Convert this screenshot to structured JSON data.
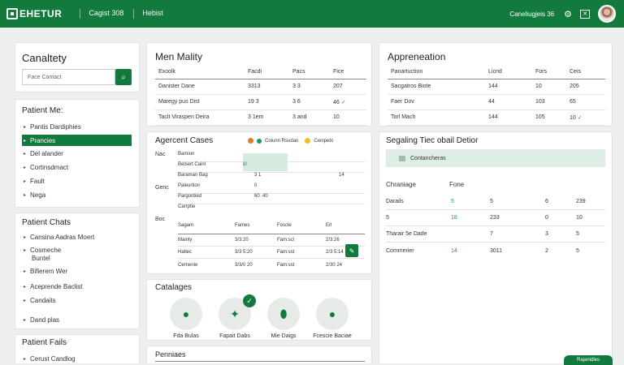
{
  "header": {
    "logo": "EHETUR",
    "logo_sub": "",
    "nav": [
      "Cagist 308",
      "Hebist"
    ],
    "user_text": "Caneliugjeis 36"
  },
  "left": {
    "capability": {
      "title": "Canaltety",
      "search_placeholder": "Face Cantact"
    },
    "patient_menu": {
      "title": "Patient Me:",
      "items": [
        "Pantis Dardiphies",
        "Prancies",
        "Del alander",
        "Cortinsdmact",
        "Fault",
        "Nega"
      ]
    },
    "patient_chats": {
      "title": "Patient Chats",
      "items": [
        "Cansina Aadras Moert",
        "Cosmeche",
        "Buntel",
        "Bifierem Wer",
        "Aceprende Baclist",
        "Candaits",
        "Dand plas"
      ]
    },
    "patient_fails": {
      "title": "Patient Fails",
      "items": [
        "Cerust Candlog"
      ]
    }
  },
  "main_mality": {
    "title": "Men Mality",
    "head": [
      "Exoolk",
      "",
      "Facdi",
      "Pacs",
      "Fice"
    ],
    "rows": [
      [
        "Danister Dane",
        "3313",
        "",
        "3 3",
        "207"
      ],
      [
        "Maregy pus Dist",
        "19 3",
        "",
        "3 6",
        "46"
      ],
      [
        "Taclt Viraspen Deira",
        "3 1em",
        "",
        "3 and",
        "10"
      ]
    ]
  },
  "appreciation": {
    "title": "Appreneation",
    "head": [
      "Panartuction",
      "",
      "Licnd",
      "Fors",
      "Ceis"
    ],
    "rows": [
      [
        "Sacgatros Biote",
        "144",
        "",
        "10",
        "205"
      ],
      [
        "Faer Dov",
        "44",
        "",
        "103",
        "65"
      ],
      [
        "Torl Mach",
        "144",
        "",
        "105",
        "10"
      ]
    ]
  },
  "agent_codes": {
    "title": "Agercent Cases",
    "legend": [
      "Coiunn Rsudan",
      "Cenipeto"
    ],
    "sections": [
      {
        "label": "Nac",
        "rows": [
          [
            "Bamion",
            "",
            "",
            ""
          ],
          [
            "Belsert Cainl",
            "8/",
            "",
            ""
          ],
          [
            "Baraman Bag",
            "3 1",
            "",
            "14"
          ]
        ]
      },
      {
        "label": "Genc",
        "rows": [
          [
            "Paleurtion",
            "0",
            "",
            ""
          ],
          [
            "Pargontied",
            "60",
            "40",
            ""
          ],
          [
            "Carrptie",
            "",
            "",
            ""
          ]
        ]
      },
      {
        "label": "Boc",
        "rows": [
          [
            "Sagam",
            "Fames",
            "Foscle",
            "Erl"
          ],
          [
            "Mainly",
            "3/3:20",
            "Fam:scl",
            "2/3:26"
          ],
          [
            "Hatlec",
            "3/3 5:20",
            "Fam:sst",
            "2/3 5:14"
          ],
          [
            "Cernenie",
            "3/3/0 20",
            "Fam:sst",
            "2/30 24"
          ]
        ]
      }
    ]
  },
  "sealing": {
    "title": "Segaling Tiec obail Detior",
    "banner": "Contancheras",
    "head": [
      "Chraniage",
      "Fone",
      "",
      ""
    ],
    "rows": [
      [
        "Darails",
        "5",
        "6",
        "239"
      ],
      [
        "18",
        "233",
        "0",
        "10"
      ],
      [
        "Tharair 5e Dade",
        "7",
        "3",
        "5"
      ],
      [
        "Commerier",
        "3011",
        "2",
        "5"
      ]
    ],
    "row1_prefix": [
      "",
      "",
      ""
    ],
    "flags": [
      "5",
      "18",
      "",
      "14"
    ]
  },
  "catalogs": {
    "title": "Catalages",
    "items": [
      "Fda Bulas",
      "Fapait Dabs",
      "Mie Daigs",
      "Fcescie Baciae"
    ]
  },
  "pennions": {
    "title": "Penniaes"
  },
  "footer_button": "Rajanidles"
}
